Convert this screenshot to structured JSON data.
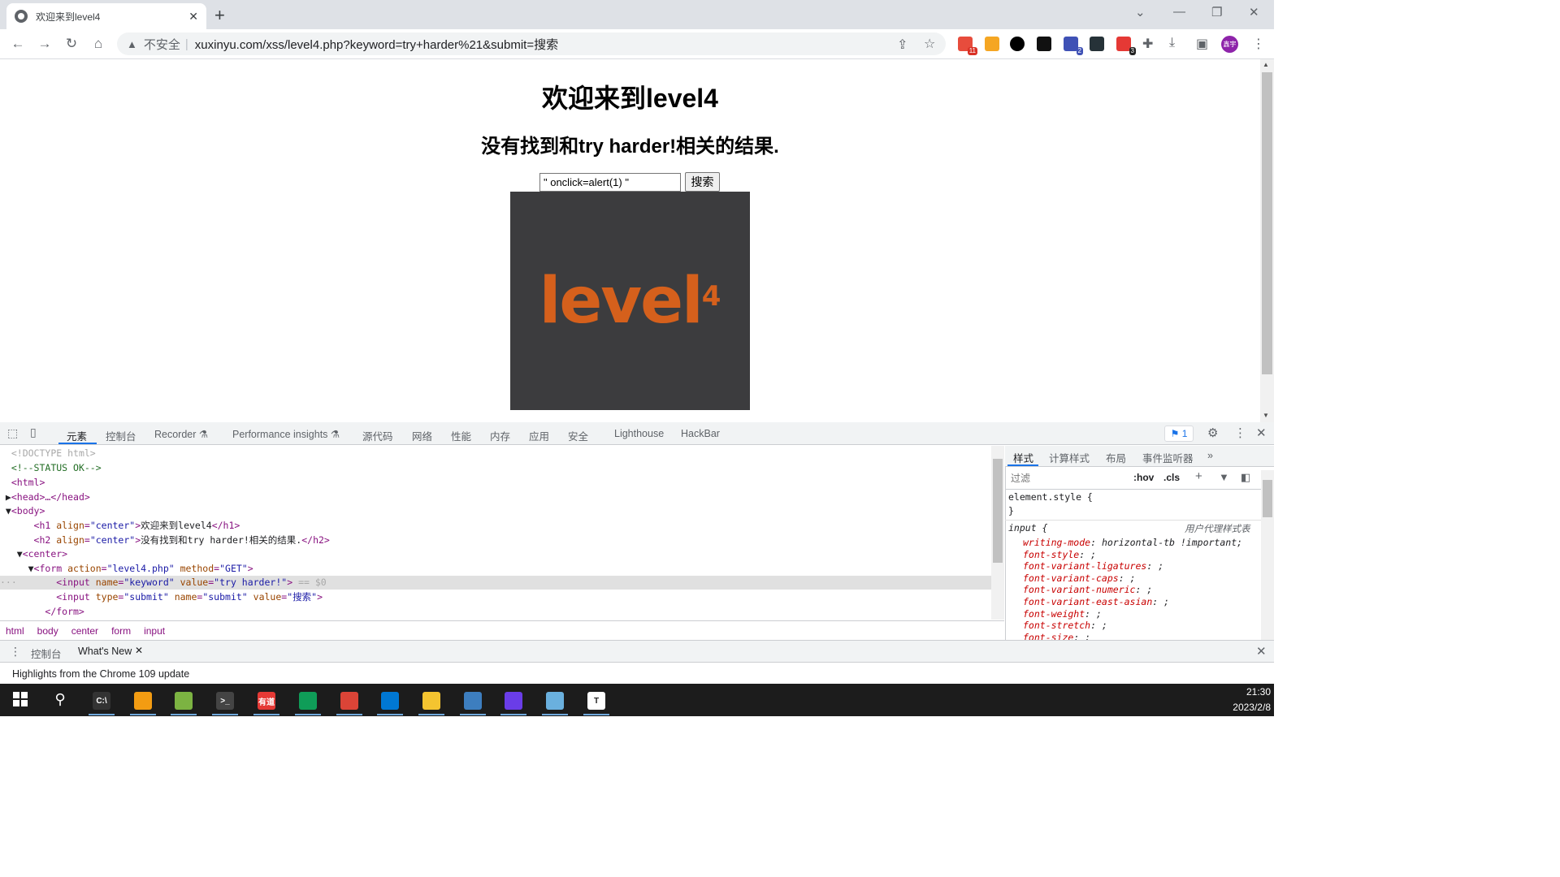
{
  "browser": {
    "tab_title": "欢迎来到level4",
    "url_security": "不安全",
    "url": "xuxinyu.com/xss/level4.php?keyword=try+harder%21&submit=搜索",
    "avatar_label": "鑫宇",
    "ext_badges": [
      "11",
      "2",
      "3"
    ]
  },
  "page": {
    "h1": "欢迎来到level4",
    "h2": "没有找到和try harder!相关的结果.",
    "keyword_value": "\" onclick=alert(1) \"",
    "submit_label": "搜索",
    "logo_text": "level",
    "logo_sup": "4"
  },
  "devtools": {
    "tabs": [
      "元素",
      "控制台",
      "Recorder",
      "Performance insights",
      "源代码",
      "网络",
      "性能",
      "内存",
      "应用",
      "安全",
      "Lighthouse",
      "HackBar"
    ],
    "issues_count": "1",
    "dom_lines": [
      {
        "indent": "  ",
        "html": "<!DOCTYPE html>",
        "kind": "doctype"
      },
      {
        "indent": "  ",
        "html": "<!--STATUS OK-->",
        "kind": "comment"
      },
      {
        "indent": "  ",
        "html": "<html>",
        "kind": "tag"
      },
      {
        "indent": " ▶",
        "html": "<head>…</head>",
        "kind": "tag"
      },
      {
        "indent": " ▼",
        "html": "<body>",
        "kind": "tag"
      },
      {
        "indent": "      ",
        "html": "h1",
        "kind": "h1"
      },
      {
        "indent": "      ",
        "html": "h2",
        "kind": "h2"
      },
      {
        "indent": "   ▼",
        "html": "<center>",
        "kind": "tag"
      },
      {
        "indent": "     ▼",
        "html": "form",
        "kind": "form"
      },
      {
        "indent": "          ",
        "html": "input1",
        "kind": "input1"
      },
      {
        "indent": "          ",
        "html": "input2",
        "kind": "input2"
      },
      {
        "indent": "        ",
        "html": "</form>",
        "kind": "tag"
      }
    ],
    "h1_text": "欢迎来到level4",
    "h2_text": "没有找到和try harder!相关的结果.",
    "selected_marker": "== $0",
    "breadcrumbs": [
      "html",
      "body",
      "center",
      "form",
      "input"
    ],
    "styles_tabs": [
      "样式",
      "计算样式",
      "布局",
      "事件监听器"
    ],
    "filter_placeholder": "过滤",
    "hov": ":hov",
    "cls": ".cls",
    "element_style": "element.style {",
    "close_brace": "}",
    "ua_selector": "input {",
    "ua_label": "用户代理样式表",
    "ua_props": [
      {
        "name": "writing-mode",
        "value": "horizontal-tb !important;"
      },
      {
        "name": "font-style",
        "value": ";"
      },
      {
        "name": "font-variant-ligatures",
        "value": ";"
      },
      {
        "name": "font-variant-caps",
        "value": ";"
      },
      {
        "name": "font-variant-numeric",
        "value": ";"
      },
      {
        "name": "font-variant-east-asian",
        "value": ";"
      },
      {
        "name": "font-weight",
        "value": ";"
      },
      {
        "name": "font-stretch",
        "value": ";"
      },
      {
        "name": "font-size",
        "value": ";"
      }
    ],
    "drawer_tabs": [
      "控制台",
      "What's New"
    ],
    "drawer_text": "Highlights from the Chrome 109 update"
  },
  "taskbar": {
    "time": "21:30",
    "date": "2023/2/8",
    "apps": [
      {
        "name": "terminal-cmd",
        "color": "#333333",
        "label": "C:\\"
      },
      {
        "name": "search-tool",
        "color": "#f39c12",
        "label": ""
      },
      {
        "name": "notepad-plus",
        "color": "#7cb342",
        "label": ""
      },
      {
        "name": "powershell",
        "color": "#444444",
        "label": ">_"
      },
      {
        "name": "youdao",
        "color": "#e53935",
        "label": "有道"
      },
      {
        "name": "edge",
        "color": "#0f9d58",
        "label": ""
      },
      {
        "name": "chrome",
        "color": "#db4437",
        "label": ""
      },
      {
        "name": "outlook",
        "color": "#0078d4",
        "label": ""
      },
      {
        "name": "file-explorer",
        "color": "#f4c430",
        "label": ""
      },
      {
        "name": "remote-desktop",
        "color": "#3d7ebf",
        "label": ""
      },
      {
        "name": "power-app",
        "color": "#6a3de8",
        "label": ""
      },
      {
        "name": "notes-app",
        "color": "#6ab0de",
        "label": ""
      },
      {
        "name": "typora",
        "color": "#ffffff",
        "label": "T"
      }
    ]
  }
}
